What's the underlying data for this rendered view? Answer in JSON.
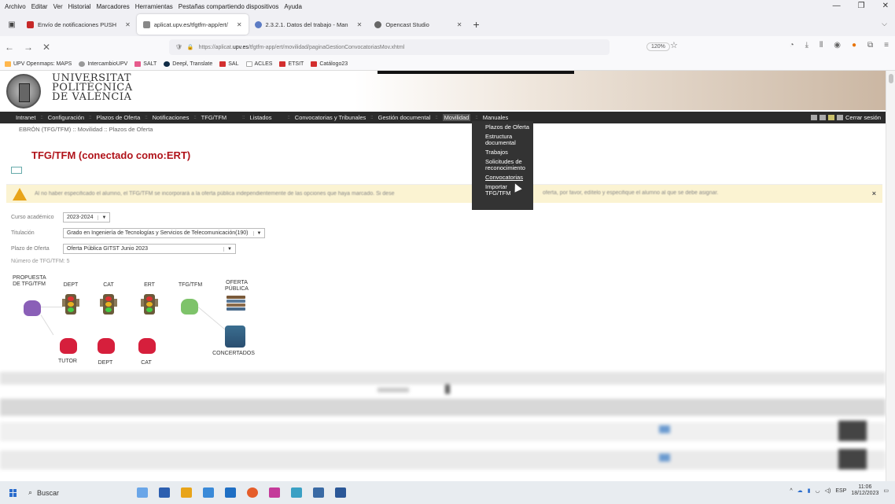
{
  "firefox_menu": [
    "Archivo",
    "Editar",
    "Ver",
    "Historial",
    "Marcadores",
    "Herramientas",
    "Pestañas compartiendo dispositivos",
    "Ayuda"
  ],
  "tabs": [
    {
      "title": "Envío de notificaciones PUSH",
      "color": "#c62828",
      "active": false
    },
    {
      "title": "aplicat.upv.es/tfgtfm-app/ert/",
      "color": "#888888",
      "active": true
    },
    {
      "title": "2.3.2.1. Datos del trabajo - Man",
      "color": "#5c7cc4",
      "active": false
    },
    {
      "title": "Opencast Studio",
      "color": "#666666",
      "active": false
    }
  ],
  "url": {
    "prefix": "https://aplicat.",
    "domain": "upv.es",
    "path": "/tfgtfm-app/ert/movilidad/paginaGestionConvocatoriasMov.xhtml"
  },
  "zoom": "120%",
  "bookmarks": [
    "UPV Openmaps: MAPS",
    "IntercambioUPV",
    "SALT",
    "Deepl, Translate",
    "SAL",
    "ACLES",
    "ETSIT",
    "Catálogo23"
  ],
  "university_name": [
    "UNIVERSITAT",
    "POLITÈCNICA",
    "DE VALÈNCIA"
  ],
  "main_nav": [
    "Intranet",
    "Configuración",
    "Plazos de Oferta",
    "Notificaciones",
    "TFG/TFM",
    "Listados",
    "Convocatorias y Tribunales",
    "Gestión documental",
    "Movilidad",
    "Manuales"
  ],
  "logout_label": "Cerrar sesión",
  "breadcrumb": "EBRÓN (TFG/TFM) :: Movilidad :: Plazos de Oferta",
  "dropdown_items": [
    "Plazos de Oferta",
    "Estructura documental",
    "Trabajos",
    "Solicitudes de reconocimiento",
    "Convocatorias",
    "Importar TFG/TFM"
  ],
  "page_title": "TFG/TFM (conectado como:ERT)",
  "warning": {
    "text_left": "Al no haber especificado el alumno, el TFG/TFM se incorporará a la oferta pública independientemente de las opciones que haya marcado. Si dese",
    "text_right": "oferta, por favor, edítelo y especifique el alumno al que se debe asignar.",
    "close": "×"
  },
  "form": {
    "curso_label": "Curso académico",
    "curso_value": "2023-2024",
    "titulacion_label": "Titulación",
    "titulacion_value": "Grado en Ingeniería de Tecnologías y Servicios de Telecomunicación(190)",
    "plazo_label": "Plazo de Oferta",
    "plazo_value": "Oferta Pública GITST Junio 2023",
    "numero_label": "Número de TFG/TFM: 5"
  },
  "flow": {
    "propuesta": "PROPUESTA DE TFG/TFM",
    "dept": "DEPT",
    "cat": "CAT",
    "ert": "ERT",
    "tfgtfm": "TFG/TFM",
    "oferta": "OFERTA PÚBLICA",
    "tutor": "TUTOR",
    "dept2": "DEPT",
    "cat2": "CAT",
    "concertados": "CONCERTADOS"
  },
  "taskbar": {
    "search": "Buscar",
    "lang": "ESP",
    "time": "11:06",
    "date": "18/12/2023"
  }
}
